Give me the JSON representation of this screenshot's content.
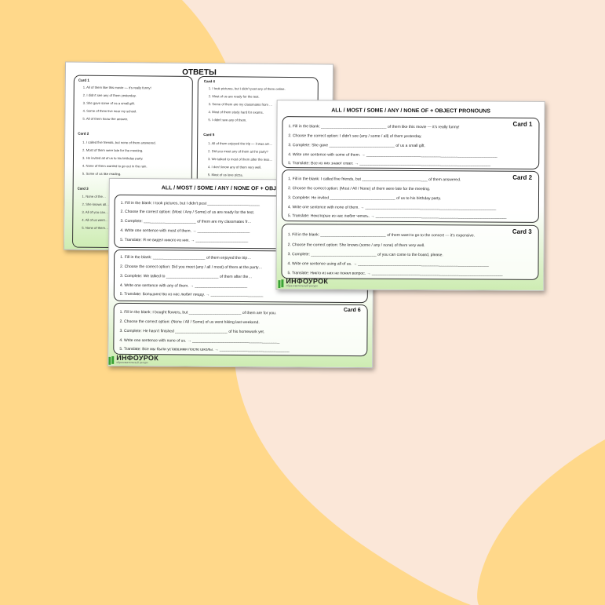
{
  "colors": {
    "bg_pink": "#fbe7d8",
    "bg_yellow": "#ffd88a",
    "green": "#3aa335"
  },
  "answers_sheet": {
    "title": "ОТВЕТЫ",
    "cards": [
      {
        "label": "Card 1",
        "lines": [
          "1. All of them like this movie — it's really funny!",
          "2. I didn't see any of them yesterday.",
          "3. She gave some of us a small gift.",
          "4. Some of them live near my school.",
          "5. All of them know the answer."
        ]
      },
      {
        "label": "Card 4",
        "lines": [
          "1. I took pictures, but I didn't post any of them online.",
          "2. Most of us are ready for the test.",
          "3. Some of them are my classmates from …",
          "4. Most of them study hard for exams.",
          "5. I didn't see any of them."
        ]
      },
      {
        "label": "Card 2",
        "lines": [
          "1. I called five friends, but none of them answered.",
          "2. Most of them were late for the meeting.",
          "3. He invited all of us to his birthday party.",
          "4. None of them wanted to go out in the rain.",
          "5. Some of us like reading."
        ]
      },
      {
        "label": "Card 5",
        "lines": [
          "1. All of them enjoyed the trip — it was am…",
          "2. Did you meet any of them at the party?",
          "3. We talked to most of them after the less…",
          "4. I don't know any of them very well.",
          "5. Most of us love pizza."
        ]
      },
      {
        "label": "Card 3",
        "lines": [
          "1. None of the…",
          "2. She knows all…",
          "3. All of you can…",
          "4. All of us went…",
          "5. None of them…"
        ]
      }
    ]
  },
  "worksheet_b": {
    "title": "ALL / MOST / SOME / ANY / NONE OF + OBJ",
    "cards": [
      {
        "label": "",
        "lines": [
          "1. Fill in the blank: I took pictures, but I didn't post ________________________",
          "2. Choose the correct option: (Most / Any / Some) of us are ready for the test.",
          "3. Complete: ________________________ of them are my classmates fr…",
          "4. Write one sentence with most of them. → ________________________",
          "5. Translate: Я не видел никого из них. → ________________________"
        ]
      },
      {
        "label": "",
        "lines": [
          "1. Fill in the blank: ________________________ of them enjoyed the trip…",
          "2. Choose the correct option: Did you meet (any / all / most) of them at the party…",
          "3. Complete: We talked to ________________________ of them after the…",
          "4. Write one sentence with any of them. → ________________________",
          "5. Translate: Большинство из нас любит пиццу. → ________________________"
        ]
      },
      {
        "label": "Card 6",
        "lines": [
          "1. Fill in the blank: I bought flowers, but ________________________ of them are for you.",
          "2. Choose the correct option: (None / All / Some) of us went hiking last weekend.",
          "3. Complete: He hasn't finished ________________________ of his homework yet.",
          "4. Write one sentence with none of us. → ________________________________________",
          "5. Translate: Все мы были уставшими после школы. → ________________________________"
        ]
      }
    ],
    "logo": {
      "name": "ИНФОУРОК",
      "tagline": "образовательный ресурс"
    }
  },
  "worksheet_c": {
    "title": "ALL / MOST / SOME / ANY / NONE OF + OBJECT PRONOUNS",
    "cards": [
      {
        "label": "Card 1",
        "lines": [
          "1. Fill in the blank: ______________________________ of them like this movie — it's really funny!",
          "2. Choose the correct option: I didn't see (any / some / all) of them yesterday.",
          "3. Complete: She gave ______________________________ of us a small gift.",
          "4. Write one sentence with some of them. → ____________________________________________________________",
          "5. Translate: Все из них знают ответ. → ____________________________________________________________"
        ]
      },
      {
        "label": "Card 2",
        "lines": [
          "1. Fill in the blank: I called five friends, but ______________________________ of them answered.",
          "2. Choose the correct option: (Most / All / None) of them were late for the meeting.",
          "3. Complete: He invited ______________________________ of us to his birthday party.",
          "4. Write one sentence with none of them. → ____________________________________________________________",
          "5. Translate: Некоторые из нас любят читать. → ____________________________________________________________"
        ]
      },
      {
        "label": "Card 3",
        "lines": [
          "1. Fill in the blank: ______________________________ of them want to go to the concert — it's expensive.",
          "2. Choose the correct option: She knows (some / any / none) of them very well.",
          "3. Complete: ______________________________ of you can come to the board, please.",
          "4. Write one sentence using all of us. → ____________________________________________________________",
          "5. Translate: Никто из них не понял вопрос. → ____________________________________________________________"
        ]
      }
    ],
    "logo": {
      "name": "ИНФОУРОК",
      "tagline": "образовательный ресурс"
    }
  }
}
